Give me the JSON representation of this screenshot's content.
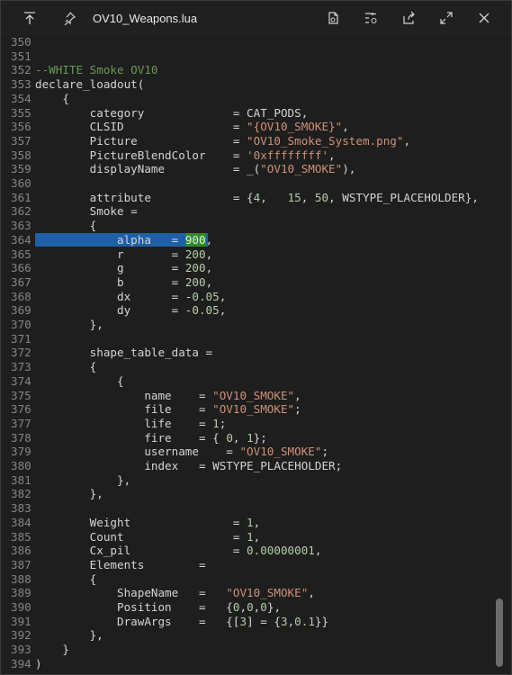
{
  "window": {
    "title": "OV10_Weapons.lua",
    "icons": [
      "move-top-icon",
      "pin-icon",
      "save-icon",
      "settings-icon",
      "share-icon",
      "expand-icon",
      "close-icon"
    ]
  },
  "colors": {
    "comment": "#6a9955",
    "string": "#ce9178",
    "number": "#b5cea8",
    "selection": "#1f5fa6",
    "match": "#2d8a2d"
  },
  "lines": [
    {
      "n": "350",
      "parts": []
    },
    {
      "n": "351",
      "parts": []
    },
    {
      "n": "352",
      "parts": [
        {
          "t": "--WHITE Smoke OV10",
          "c": "comment"
        }
      ]
    },
    {
      "n": "353",
      "parts": [
        {
          "t": "declare_loadout(",
          "c": "plain"
        }
      ]
    },
    {
      "n": "354",
      "parts": [
        {
          "t": "    {",
          "c": "plain"
        }
      ]
    },
    {
      "n": "355",
      "parts": [
        {
          "t": "        category             = CAT_PODS,",
          "c": "plain"
        }
      ]
    },
    {
      "n": "356",
      "parts": [
        {
          "t": "        CLSID                = ",
          "c": "plain"
        },
        {
          "t": "\"{OV10_SMOKE}\"",
          "c": "str"
        },
        {
          "t": ",",
          "c": "plain"
        }
      ]
    },
    {
      "n": "357",
      "parts": [
        {
          "t": "        Picture              = ",
          "c": "plain"
        },
        {
          "t": "\"OV10_Smoke_System.png\"",
          "c": "str"
        },
        {
          "t": ",",
          "c": "plain"
        }
      ]
    },
    {
      "n": "358",
      "parts": [
        {
          "t": "        PictureBlendColor    = ",
          "c": "plain"
        },
        {
          "t": "'0xffffffff'",
          "c": "str"
        },
        {
          "t": ",",
          "c": "plain"
        }
      ]
    },
    {
      "n": "359",
      "parts": [
        {
          "t": "        displayName          = _(",
          "c": "plain"
        },
        {
          "t": "\"OV10_SMOKE\"",
          "c": "str"
        },
        {
          "t": "),",
          "c": "plain"
        }
      ]
    },
    {
      "n": "360",
      "parts": []
    },
    {
      "n": "361",
      "parts": [
        {
          "t": "        attribute            = {",
          "c": "plain"
        },
        {
          "t": "4",
          "c": "num"
        },
        {
          "t": ",   ",
          "c": "plain"
        },
        {
          "t": "15",
          "c": "num"
        },
        {
          "t": ", ",
          "c": "plain"
        },
        {
          "t": "50",
          "c": "num"
        },
        {
          "t": ", WSTYPE_PLACEHOLDER},",
          "c": "plain"
        }
      ]
    },
    {
      "n": "362",
      "parts": [
        {
          "t": "        Smoke =",
          "c": "plain"
        }
      ]
    },
    {
      "n": "363",
      "parts": [
        {
          "t": "        {",
          "c": "plain"
        }
      ]
    },
    {
      "n": "364",
      "parts": [
        {
          "t": "            alpha   = ",
          "c": "plain"
        },
        {
          "t": "900",
          "c": "match"
        },
        {
          "t": ",",
          "c": "plain"
        }
      ],
      "selected": true
    },
    {
      "n": "365",
      "parts": [
        {
          "t": "            r       = ",
          "c": "plain"
        },
        {
          "t": "200",
          "c": "num"
        },
        {
          "t": ",",
          "c": "plain"
        }
      ]
    },
    {
      "n": "366",
      "parts": [
        {
          "t": "            g       = ",
          "c": "plain"
        },
        {
          "t": "200",
          "c": "num"
        },
        {
          "t": ",",
          "c": "plain"
        }
      ]
    },
    {
      "n": "367",
      "parts": [
        {
          "t": "            b       = ",
          "c": "plain"
        },
        {
          "t": "200",
          "c": "num"
        },
        {
          "t": ",",
          "c": "plain"
        }
      ]
    },
    {
      "n": "368",
      "parts": [
        {
          "t": "            dx      = -",
          "c": "plain"
        },
        {
          "t": "0.05",
          "c": "num"
        },
        {
          "t": ",",
          "c": "plain"
        }
      ]
    },
    {
      "n": "369",
      "parts": [
        {
          "t": "            dy      = -",
          "c": "plain"
        },
        {
          "t": "0.05",
          "c": "num"
        },
        {
          "t": ",",
          "c": "plain"
        }
      ]
    },
    {
      "n": "370",
      "parts": [
        {
          "t": "        },",
          "c": "plain"
        }
      ]
    },
    {
      "n": "371",
      "parts": []
    },
    {
      "n": "372",
      "parts": [
        {
          "t": "        shape_table_data =",
          "c": "plain"
        }
      ]
    },
    {
      "n": "373",
      "parts": [
        {
          "t": "        {",
          "c": "plain"
        }
      ]
    },
    {
      "n": "374",
      "parts": [
        {
          "t": "            {",
          "c": "plain"
        }
      ]
    },
    {
      "n": "375",
      "parts": [
        {
          "t": "                name    = ",
          "c": "plain"
        },
        {
          "t": "\"OV10_SMOKE\"",
          "c": "str"
        },
        {
          "t": ",",
          "c": "plain"
        }
      ]
    },
    {
      "n": "376",
      "parts": [
        {
          "t": "                file    = ",
          "c": "plain"
        },
        {
          "t": "\"OV10_SMOKE\"",
          "c": "str"
        },
        {
          "t": ";",
          "c": "plain"
        }
      ]
    },
    {
      "n": "377",
      "parts": [
        {
          "t": "                life    = ",
          "c": "plain"
        },
        {
          "t": "1",
          "c": "num"
        },
        {
          "t": ";",
          "c": "plain"
        }
      ]
    },
    {
      "n": "378",
      "parts": [
        {
          "t": "                fire    = { ",
          "c": "plain"
        },
        {
          "t": "0",
          "c": "num"
        },
        {
          "t": ", ",
          "c": "plain"
        },
        {
          "t": "1",
          "c": "num"
        },
        {
          "t": "};",
          "c": "plain"
        }
      ]
    },
    {
      "n": "379",
      "parts": [
        {
          "t": "                username    = ",
          "c": "plain"
        },
        {
          "t": "\"OV10_SMOKE\"",
          "c": "str"
        },
        {
          "t": ";",
          "c": "plain"
        }
      ]
    },
    {
      "n": "380",
      "parts": [
        {
          "t": "                index   = WSTYPE_PLACEHOLDER;",
          "c": "plain"
        }
      ]
    },
    {
      "n": "381",
      "parts": [
        {
          "t": "            },",
          "c": "plain"
        }
      ]
    },
    {
      "n": "382",
      "parts": [
        {
          "t": "        },",
          "c": "plain"
        }
      ]
    },
    {
      "n": "383",
      "parts": []
    },
    {
      "n": "384",
      "parts": [
        {
          "t": "        Weight               = ",
          "c": "plain"
        },
        {
          "t": "1",
          "c": "num"
        },
        {
          "t": ",",
          "c": "plain"
        }
      ]
    },
    {
      "n": "385",
      "parts": [
        {
          "t": "        Count                = ",
          "c": "plain"
        },
        {
          "t": "1",
          "c": "num"
        },
        {
          "t": ",",
          "c": "plain"
        }
      ]
    },
    {
      "n": "386",
      "parts": [
        {
          "t": "        Cx_pil               = ",
          "c": "plain"
        },
        {
          "t": "0.00000001",
          "c": "num"
        },
        {
          "t": ",",
          "c": "plain"
        }
      ]
    },
    {
      "n": "387",
      "parts": [
        {
          "t": "        Elements        =",
          "c": "plain"
        }
      ]
    },
    {
      "n": "388",
      "parts": [
        {
          "t": "        {",
          "c": "plain"
        }
      ]
    },
    {
      "n": "389",
      "parts": [
        {
          "t": "            ShapeName   =   ",
          "c": "plain"
        },
        {
          "t": "\"OV10_SMOKE\"",
          "c": "str"
        },
        {
          "t": ",",
          "c": "plain"
        }
      ]
    },
    {
      "n": "390",
      "parts": [
        {
          "t": "            Position    =   {",
          "c": "plain"
        },
        {
          "t": "0",
          "c": "num"
        },
        {
          "t": ",",
          "c": "plain"
        },
        {
          "t": "0",
          "c": "num"
        },
        {
          "t": ",",
          "c": "plain"
        },
        {
          "t": "0",
          "c": "num"
        },
        {
          "t": "},",
          "c": "plain"
        }
      ]
    },
    {
      "n": "391",
      "parts": [
        {
          "t": "            DrawArgs    =   {[",
          "c": "plain"
        },
        {
          "t": "3",
          "c": "num"
        },
        {
          "t": "] = {",
          "c": "plain"
        },
        {
          "t": "3",
          "c": "num"
        },
        {
          "t": ",",
          "c": "plain"
        },
        {
          "t": "0.1",
          "c": "num"
        },
        {
          "t": "}}",
          "c": "plain"
        }
      ]
    },
    {
      "n": "392",
      "parts": [
        {
          "t": "        },",
          "c": "plain"
        }
      ]
    },
    {
      "n": "393",
      "parts": [
        {
          "t": "    }",
          "c": "plain"
        }
      ]
    },
    {
      "n": "394",
      "parts": [
        {
          "t": ")",
          "c": "plain"
        }
      ]
    }
  ]
}
